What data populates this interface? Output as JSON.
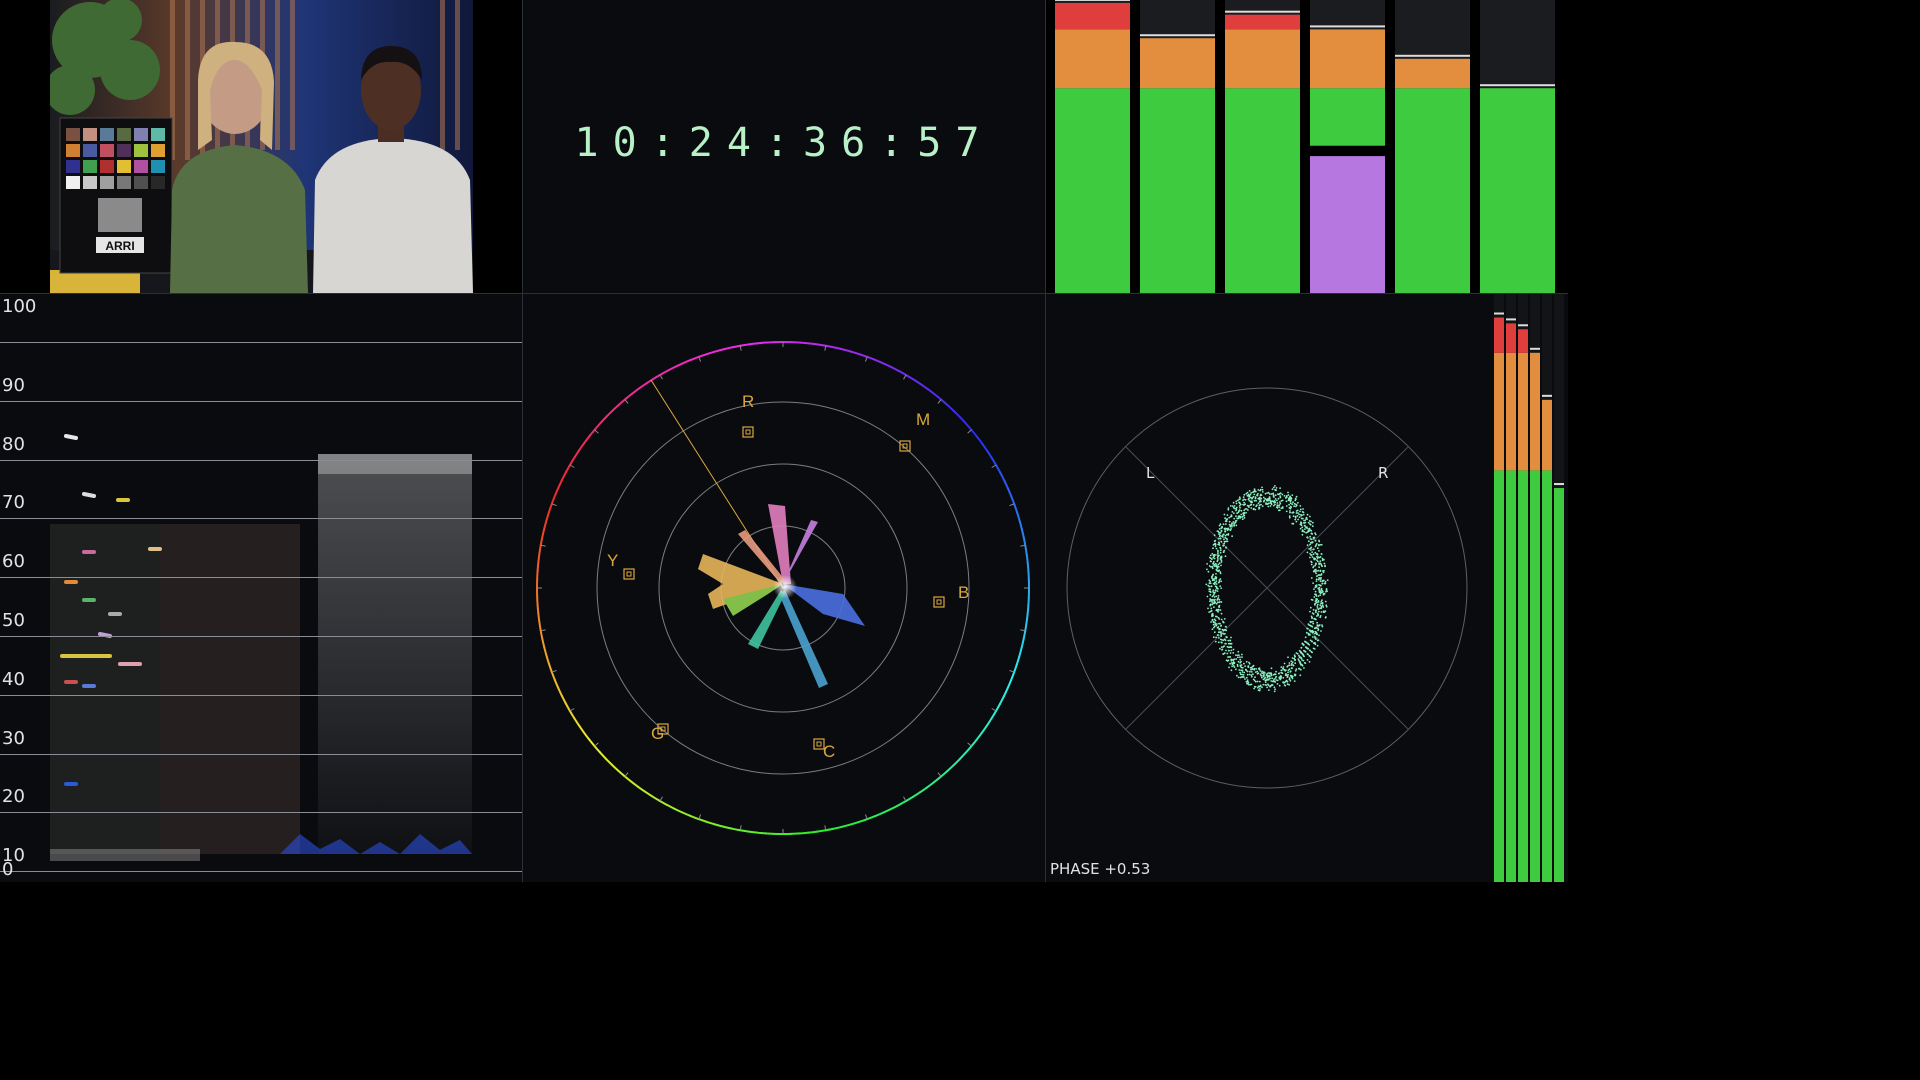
{
  "timecode": "10:24:36:57",
  "video": {
    "chart_brand": "ARRI"
  },
  "top_meters": [
    {
      "green": 0.7,
      "orange": 0.2,
      "red": 0.09
    },
    {
      "green": 0.7,
      "orange": 0.17,
      "red": 0.0
    },
    {
      "green": 0.7,
      "orange": 0.2,
      "red": 0.05
    },
    {
      "green": 0.7,
      "orange": 0.2,
      "red": 0.0,
      "alert": true
    },
    {
      "green": 0.7,
      "orange": 0.1,
      "red": 0.0
    },
    {
      "green": 0.7,
      "orange": 0.0,
      "red": 0.0
    }
  ],
  "waveform": {
    "scale": [
      "100",
      "90",
      "80",
      "70",
      "60",
      "50",
      "40",
      "30",
      "20",
      "10",
      "0"
    ]
  },
  "vectorscope": {
    "targets": [
      {
        "label": "R"
      },
      {
        "label": "M"
      },
      {
        "label": "B"
      },
      {
        "label": "C"
      },
      {
        "label": "G"
      },
      {
        "label": "Y"
      }
    ]
  },
  "stereo": {
    "left_label": "L",
    "right_label": "R",
    "phase_text": "PHASE +0.53"
  },
  "side_meters": [
    0.96,
    0.95,
    0.94,
    0.9,
    0.82,
    0.67
  ],
  "colors": {
    "meter_green": "#3ecb40",
    "meter_orange": "#e38d3f",
    "meter_red": "#e03d3d",
    "meter_purple": "#b777e0",
    "target_gold": "#d9a73d",
    "timecode": "#b8f0c8"
  }
}
